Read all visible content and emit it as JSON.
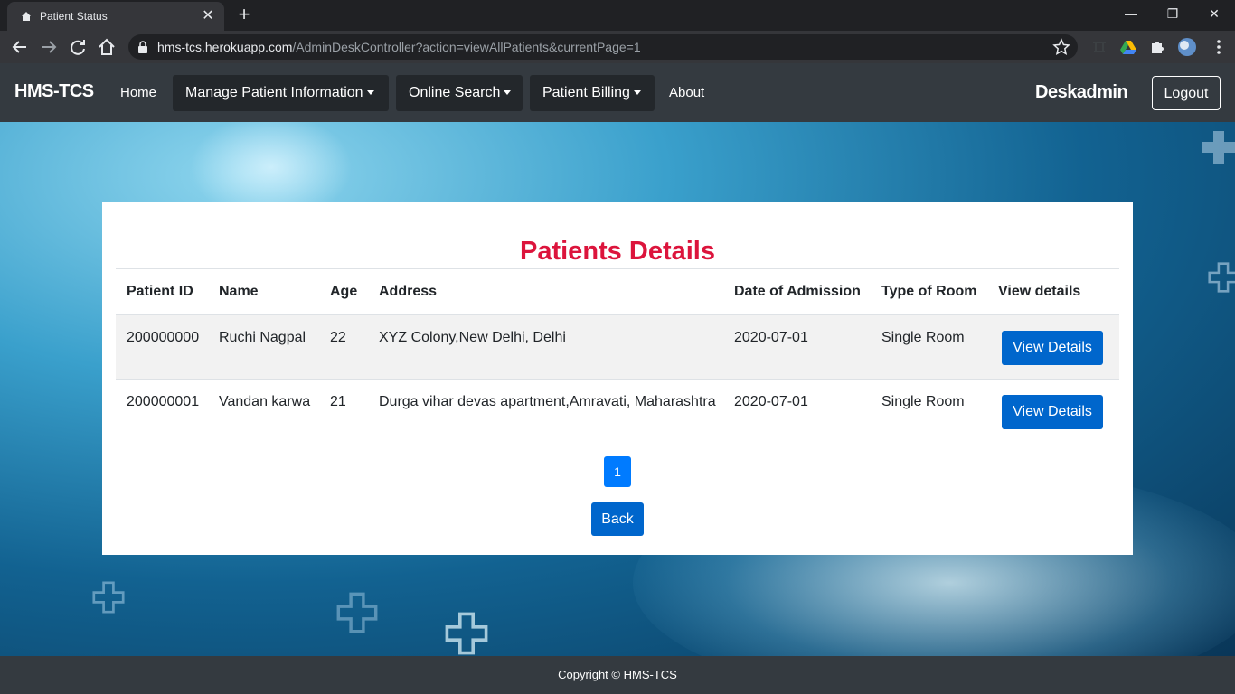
{
  "browser": {
    "tab_title": "Patient Status",
    "url_host": "hms-tcs.herokuapp.com",
    "url_path": "/AdminDeskController?action=viewAllPatients&currentPage=1"
  },
  "navbar": {
    "brand": "HMS-TCS",
    "home": "Home",
    "manage": "Manage Patient Information",
    "search": "Online Search",
    "billing": "Patient Billing",
    "about": "About",
    "user": "Deskadmin",
    "logout": "Logout"
  },
  "main": {
    "title": "Patients Details",
    "columns": [
      "Patient ID",
      "Name",
      "Age",
      "Address",
      "Date of Admission",
      "Type of Room",
      "View details"
    ],
    "rows": [
      {
        "id": "200000000",
        "name": "Ruchi Nagpal",
        "age": "22",
        "address": "XYZ Colony,New Delhi, Delhi",
        "date": "2020-07-01",
        "room": "Single Room",
        "action": "View Details"
      },
      {
        "id": "200000001",
        "name": "Vandan karwa",
        "age": "21",
        "address": "Durga vihar devas apartment,Amravati, Maharashtra",
        "date": "2020-07-01",
        "room": "Single Room",
        "action": "View Details"
      }
    ],
    "page": "1",
    "back": "Back"
  },
  "footer": {
    "text": "Copyright © HMS-TCS"
  },
  "colors": {
    "accent": "#0066cc",
    "title": "#dc143c",
    "navbar": "#343a40",
    "page_active": "#007bff"
  }
}
